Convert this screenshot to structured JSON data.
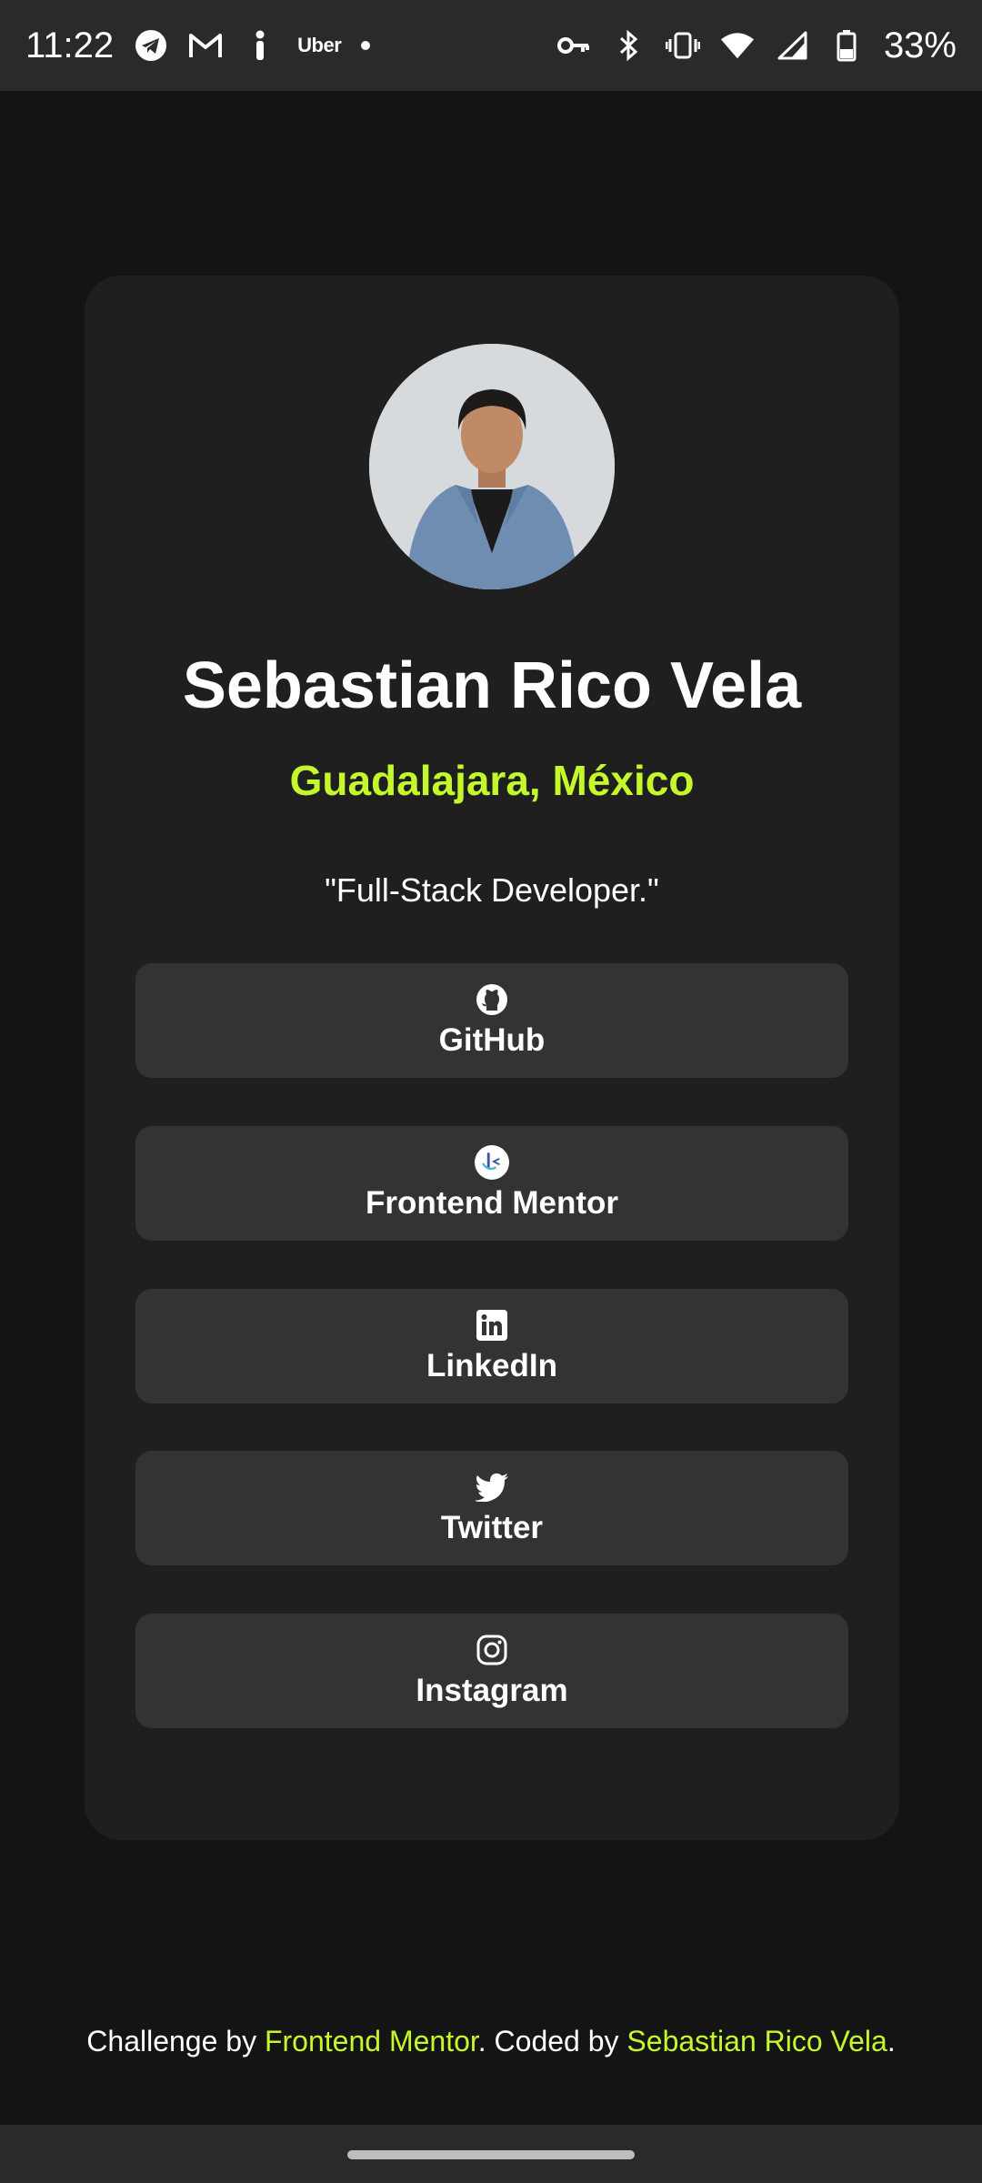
{
  "status_bar": {
    "time": "11:22",
    "uber_label": "Uber",
    "battery_percent": "33%"
  },
  "profile": {
    "name": "Sebastian Rico Vela",
    "location": "Guadalajara, México",
    "bio": "\"Full-Stack Developer.\""
  },
  "links": [
    {
      "label": "GitHub",
      "icon": "github-icon"
    },
    {
      "label": "Frontend Mentor",
      "icon": "frontend-mentor-icon"
    },
    {
      "label": "LinkedIn",
      "icon": "linkedin-icon"
    },
    {
      "label": "Twitter",
      "icon": "twitter-icon"
    },
    {
      "label": "Instagram",
      "icon": "instagram-icon"
    }
  ],
  "footer": {
    "prefix": "Challenge by ",
    "challenge_link": "Frontend Mentor",
    "middle": ". Coded by ",
    "author_link": "Sebastian Rico Vela",
    "suffix": "."
  },
  "colors": {
    "accent": "#c4f82a",
    "background": "#141414",
    "card": "#1f1f1f",
    "button": "#333333"
  }
}
